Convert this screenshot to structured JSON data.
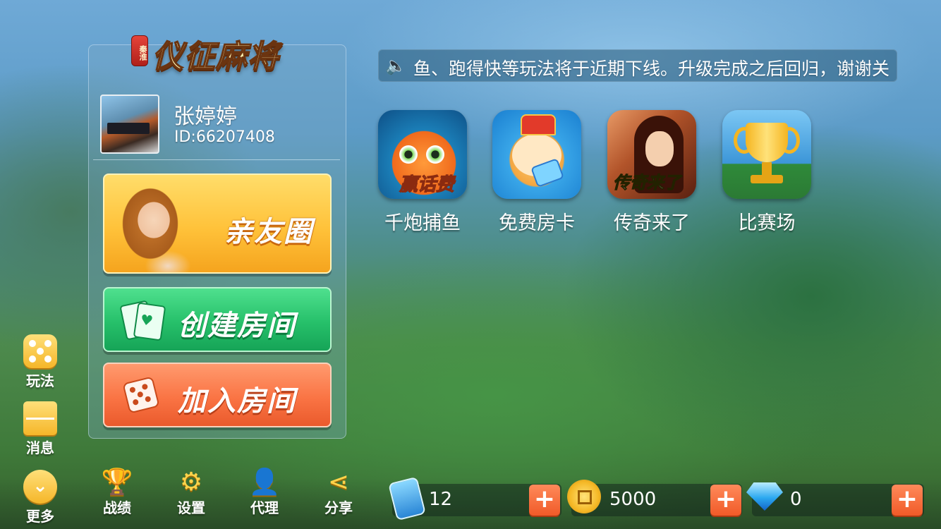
{
  "app": {
    "logo_tag": "秦淮",
    "logo_name": "仪征麻将"
  },
  "user": {
    "name": "张婷婷",
    "id_text": "ID:66207408"
  },
  "main_buttons": {
    "friends": "亲友圈",
    "create_room": "创建房间",
    "join_room": "加入房间"
  },
  "notice": {
    "text": "鱼、跑得快等玩法将于近期下线。升级完成之后回归，谢谢关"
  },
  "games": [
    {
      "label": "千炮捕鱼",
      "badge": "赢话费",
      "icon": "fish-game-icon"
    },
    {
      "label": "免费房卡",
      "icon": "dog-key-icon"
    },
    {
      "label": "传奇来了",
      "badge": "传奇来了",
      "icon": "legend-game-icon"
    },
    {
      "label": "比赛场",
      "icon": "trophy-icon"
    }
  ],
  "side_menu": [
    {
      "label": "玩法",
      "icon": "dice-icon"
    },
    {
      "label": "消息",
      "icon": "mail-icon"
    },
    {
      "label": "更多",
      "icon": "chevron-down-icon"
    }
  ],
  "bottom_nav": [
    {
      "label": "战绩",
      "icon": "trophy-icon"
    },
    {
      "label": "设置",
      "icon": "gear-icon"
    },
    {
      "label": "代理",
      "icon": "agent-icon"
    },
    {
      "label": "分享",
      "icon": "share-icon"
    }
  ],
  "currency": {
    "cards": "12",
    "coins": "5000",
    "diamonds": "0",
    "plus": "+"
  },
  "colors": {
    "friends_button": "#ffc23a",
    "create_button": "#26c06a",
    "join_button": "#fa7444",
    "plus_button": "#f05a28"
  }
}
